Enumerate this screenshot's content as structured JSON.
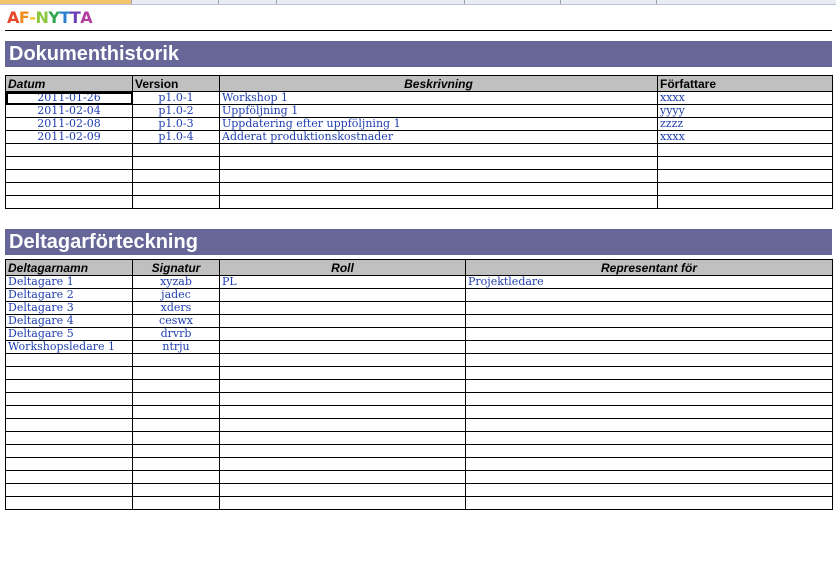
{
  "logo": {
    "letters": [
      {
        "ch": "A",
        "color": "#e8452c"
      },
      {
        "ch": "F",
        "color": "#f28c1e"
      },
      {
        "ch": "-",
        "color": "#f2c21e"
      },
      {
        "ch": "N",
        "color": "#8bc63f"
      },
      {
        "ch": "Y",
        "color": "#2fa84f"
      },
      {
        "ch": "T",
        "color": "#2e7fd1"
      },
      {
        "ch": "T",
        "color": "#6a3fb5"
      },
      {
        "ch": "A",
        "color": "#b23fa0"
      }
    ]
  },
  "history": {
    "title": "Dokumenthistorik",
    "headers": {
      "datum": "Datum",
      "version": "Version",
      "beskrivning": "Beskrivning",
      "forfattare": "Författare"
    },
    "rows": [
      {
        "datum": "2011-01-26",
        "version": "p1.0-1",
        "beskrivning": "Workshop 1",
        "forfattare": "xxxx"
      },
      {
        "datum": "2011-02-04",
        "version": "p1.0-2",
        "beskrivning": "Uppföljning 1",
        "forfattare": "yyyy"
      },
      {
        "datum": "2011-02-08",
        "version": "p1.0-3",
        "beskrivning": "Uppdatering efter uppföljning 1",
        "forfattare": "zzzz"
      },
      {
        "datum": "2011-02-09",
        "version": "p1.0-4",
        "beskrivning": "Adderat produktionskostnader",
        "forfattare": "xxxx"
      },
      {
        "datum": "",
        "version": "",
        "beskrivning": "",
        "forfattare": ""
      },
      {
        "datum": "",
        "version": "",
        "beskrivning": "",
        "forfattare": ""
      },
      {
        "datum": "",
        "version": "",
        "beskrivning": "",
        "forfattare": ""
      },
      {
        "datum": "",
        "version": "",
        "beskrivning": "",
        "forfattare": ""
      },
      {
        "datum": "",
        "version": "",
        "beskrivning": "",
        "forfattare": ""
      }
    ]
  },
  "participants": {
    "title": "Deltagarförteckning",
    "headers": {
      "namn": "Deltagarnamn",
      "signatur": "Signatur",
      "roll": "Roll",
      "representant": "Representant för"
    },
    "rows": [
      {
        "namn": "Deltagare 1",
        "signatur": "xyzab",
        "roll": "PL",
        "representant": "Projektledare"
      },
      {
        "namn": "Deltagare 2",
        "signatur": "jadec",
        "roll": "",
        "representant": ""
      },
      {
        "namn": "Deltagare 3",
        "signatur": "xders",
        "roll": "",
        "representant": ""
      },
      {
        "namn": "Deltagare 4",
        "signatur": "ceswx",
        "roll": "",
        "representant": ""
      },
      {
        "namn": "Deltagare 5",
        "signatur": "drvrb",
        "roll": "",
        "representant": ""
      },
      {
        "namn": "Workshopsledare 1",
        "signatur": "ntrju",
        "roll": "",
        "representant": ""
      },
      {
        "namn": "",
        "signatur": "",
        "roll": "",
        "representant": ""
      },
      {
        "namn": "",
        "signatur": "",
        "roll": "",
        "representant": ""
      },
      {
        "namn": "",
        "signatur": "",
        "roll": "",
        "representant": ""
      },
      {
        "namn": "",
        "signatur": "",
        "roll": "",
        "representant": ""
      },
      {
        "namn": "",
        "signatur": "",
        "roll": "",
        "representant": ""
      },
      {
        "namn": "",
        "signatur": "",
        "roll": "",
        "representant": ""
      },
      {
        "namn": "",
        "signatur": "",
        "roll": "",
        "representant": ""
      },
      {
        "namn": "",
        "signatur": "",
        "roll": "",
        "representant": ""
      },
      {
        "namn": "",
        "signatur": "",
        "roll": "",
        "representant": ""
      },
      {
        "namn": "",
        "signatur": "",
        "roll": "",
        "representant": ""
      },
      {
        "namn": "",
        "signatur": "",
        "roll": "",
        "representant": ""
      },
      {
        "namn": "",
        "signatur": "",
        "roll": "",
        "representant": ""
      }
    ]
  }
}
